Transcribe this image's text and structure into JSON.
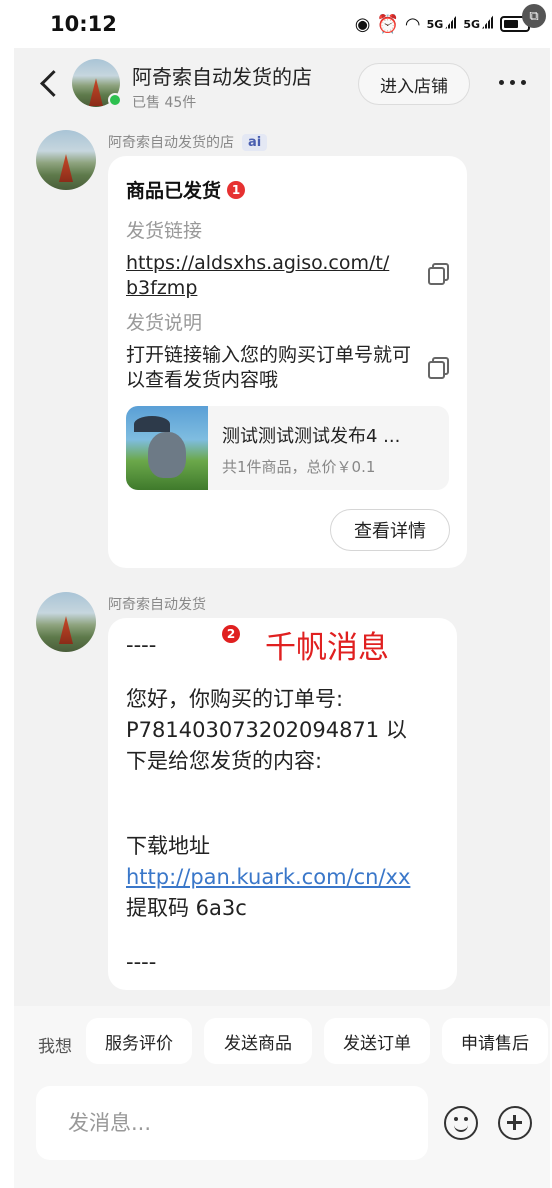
{
  "status_bar": {
    "time": "10:12",
    "icons": [
      "hotspot-icon",
      "alarm-icon",
      "wifi-icon",
      "signal-5g-icon",
      "signal-5g-icon",
      "battery-icon"
    ],
    "network_label_1": "5G",
    "network_label_2": "5G"
  },
  "header": {
    "shop_name": "阿奇索自动发货的店",
    "sold_count": "已售 45件",
    "enter_shop_label": "进入店铺"
  },
  "messages": [
    {
      "sender": "阿奇索自动发货的店",
      "badge": "ai",
      "card": {
        "title": "商品已发货",
        "title_badge": "1",
        "link_label": "发货链接",
        "link_value": "https://aldsxhs.agiso.com/t/b3fzmp",
        "note_label": "发货说明",
        "note_value": "打开链接输入您的购买订单号就可以查看发货内容哦",
        "product_title": "测试测试测试发布4 ...",
        "product_summary": "共1件商品，总价￥0.1",
        "detail_button": "查看详情"
      }
    },
    {
      "sender": "阿奇索自动发货",
      "lines": {
        "l1": "----",
        "l2": "您好，你购买的订单号:",
        "l3": "P781403073202094871 以",
        "l4": "下是给您发货的内容:",
        "l5": "下载地址",
        "l6": "http://pan.kuark.com/cn/xx",
        "l7": "提取码 6a3c",
        "l8": "----"
      },
      "annotation_badge": "2",
      "annotation_text": "千帆消息"
    }
  ],
  "quick_replies": {
    "label": "我想",
    "items": [
      "服务评价",
      "发送商品",
      "发送订单",
      "申请售后"
    ]
  },
  "input": {
    "placeholder": "发消息..."
  },
  "colors": {
    "background": "#f2f2f2",
    "online": "#2dc04f",
    "badge_red": "#e63131",
    "link_blue": "#3a77c9",
    "annotation_red": "#e02020"
  }
}
